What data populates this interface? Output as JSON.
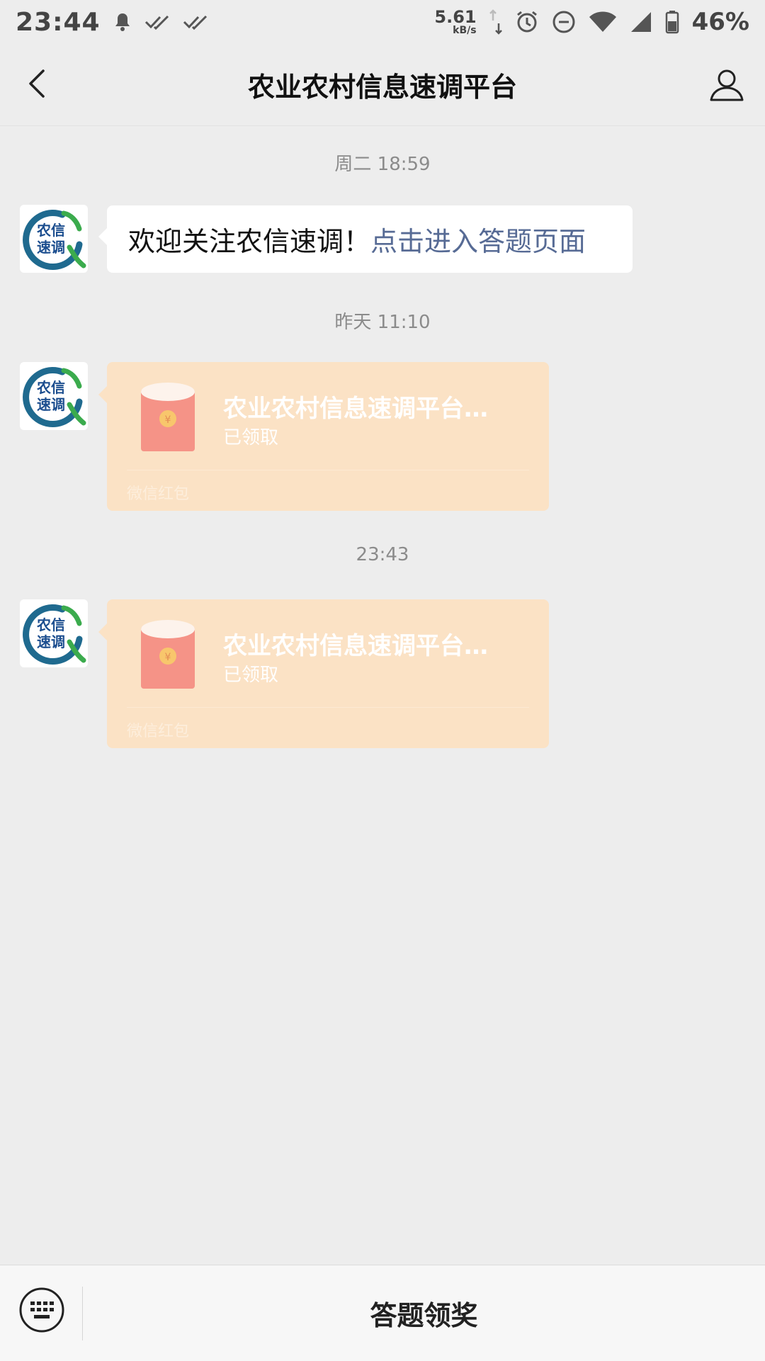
{
  "status_bar": {
    "time": "23:44",
    "net_speed": "5.61",
    "net_unit": "kB/s",
    "battery": "46%"
  },
  "header": {
    "title": "农业农村信息速调平台"
  },
  "chat": {
    "avatar_text": [
      "农信",
      "速调"
    ],
    "timestamps": [
      "周二 18:59",
      "昨天 11:10",
      "23:43"
    ],
    "welcome": {
      "text": "欢迎关注农信速调！",
      "link": "点击进入答题页面"
    },
    "red_packets": [
      {
        "title": "农业农村信息速调平台…",
        "status": "已领取",
        "footer": "微信红包"
      },
      {
        "title": "农业农村信息速调平台…",
        "status": "已领取",
        "footer": "微信红包"
      }
    ]
  },
  "bottom": {
    "menu_label": "答题领奖"
  },
  "colors": {
    "link": "#576b95",
    "red_packet_bg": "#fbe2c5",
    "background": "#ededed"
  }
}
